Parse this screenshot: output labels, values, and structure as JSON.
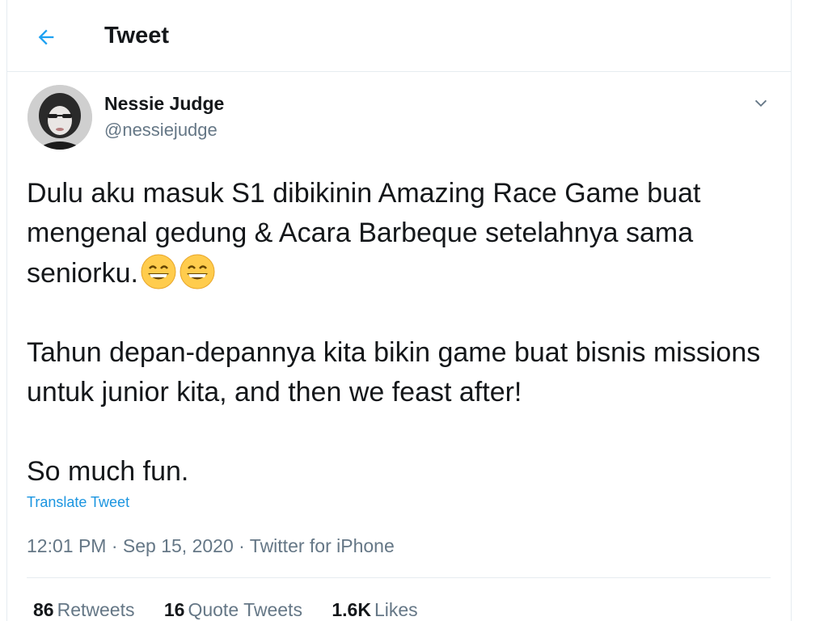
{
  "header": {
    "title": "Tweet",
    "back_icon": "arrow-left-icon",
    "accent_color": "#1da1f2"
  },
  "author": {
    "name": "Nessie Judge",
    "handle": "@nessiejudge"
  },
  "tweet": {
    "line1": "Dulu aku masuk S1 dibikinin Amazing Race Game buat mengenal gedung & Acara Barbeque setelahnya sama seniorku.",
    "line1_emojis": [
      "grinning-face-icon",
      "grinning-face-icon"
    ],
    "line2": "Tahun depan-depannya kita bikin game buat bisnis missions untuk junior kita, and then we feast after!",
    "line3": "So much fun.",
    "translate_label": "Translate Tweet"
  },
  "meta": {
    "time": "12:01 PM",
    "date": "Sep 15, 2020",
    "source": "Twitter for iPhone",
    "separator": "·"
  },
  "stats": {
    "retweets_count": "86",
    "retweets_label": "Retweets",
    "quotes_count": "16",
    "quotes_label": "Quote Tweets",
    "likes_count": "1.6K",
    "likes_label": "Likes"
  }
}
